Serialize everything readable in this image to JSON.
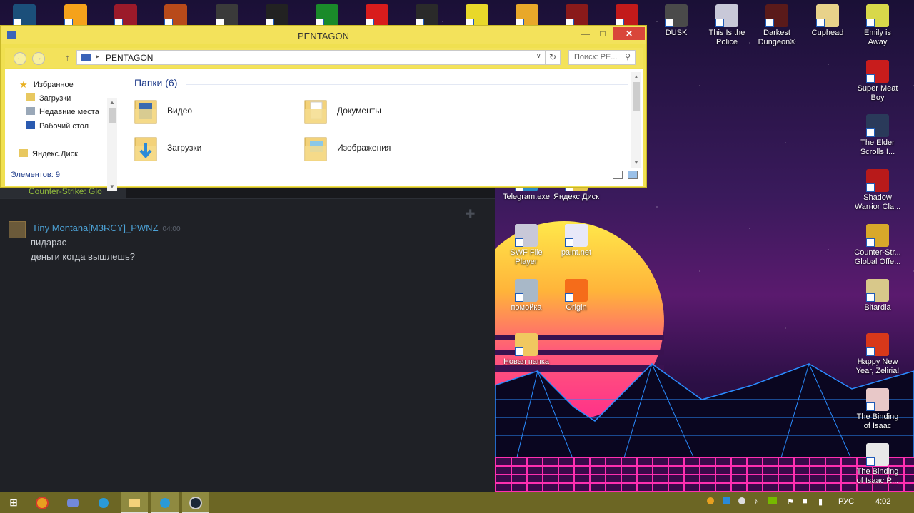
{
  "top_icons": [
    {
      "name": "steam-app-icon",
      "color": "#1b4f7a"
    },
    {
      "name": "app2-icon",
      "color": "#f5a21b"
    },
    {
      "name": "app3-icon",
      "color": "#9b1a2a"
    },
    {
      "name": "app4-icon",
      "color": "#b84a1a"
    },
    {
      "name": "app5-icon",
      "color": "#3a3a3a"
    },
    {
      "name": "app6-icon",
      "color": "#222222"
    },
    {
      "name": "app7-icon",
      "color": "#1a8a2a"
    },
    {
      "name": "app8-icon",
      "color": "#d81c1c"
    },
    {
      "name": "app9-icon",
      "color": "#2a2a2a"
    },
    {
      "name": "app10-icon",
      "color": "#e8d82a"
    },
    {
      "name": "app11-icon",
      "color": "#e8a82a"
    },
    {
      "name": "app12-icon",
      "color": "#8a1a1a"
    },
    {
      "name": "dota-icon",
      "color": "#c21a1a"
    }
  ],
  "desktop_right_top": [
    {
      "name": "DUSK",
      "color": "#4a4a4a"
    },
    {
      "name": "This Is the\nPolice",
      "color": "#c8c8d8"
    },
    {
      "name": "Darkest\nDungeon®",
      "color": "#5a1a1a"
    },
    {
      "name": "Cuphead",
      "color": "#e8d28a"
    },
    {
      "name": "Emily is\nAway",
      "color": "#d8d84a"
    }
  ],
  "desktop_right_col": [
    {
      "name": "Super Meat\nBoy",
      "color": "#c81c1c"
    },
    {
      "name": "The Elder\nScrolls I...",
      "color": "#2a3a5a"
    },
    {
      "name": "Shadow\nWarrior Cla...",
      "color": "#b81a1a"
    },
    {
      "name": "Counter-Str...\nGlobal Offe...",
      "color": "#d8a82a"
    },
    {
      "name": "Bitardia",
      "color": "#d8c88a"
    },
    {
      "name": "Happy New\nYear, Zeliria!",
      "color": "#d8381a"
    },
    {
      "name": "The Binding\nof Isaac",
      "color": "#e8c8c8"
    },
    {
      "name": "The Binding\nof Isaac R...",
      "color": "#e8e8e8"
    }
  ],
  "desktop_mid": [
    {
      "name": "Telegram.exe",
      "color": "#2a8ac8"
    },
    {
      "name": "Яндекс.Диск",
      "color": "#e8c84a"
    },
    {
      "name": "SWF File\nPlayer",
      "color": "#c8c8d8"
    },
    {
      "name": "paint.net",
      "color": "#e8e8f8"
    },
    {
      "name": "помойка",
      "color": "#a8b8c8"
    },
    {
      "name": "Origin",
      "color": "#f56c1a"
    },
    {
      "name": "Новая папка",
      "color": "#f0c860"
    }
  ],
  "explorer": {
    "title": "PENTAGON",
    "path": "PENTAGON",
    "search_placeholder": "Поиск: PE...",
    "nav": {
      "favorites": "Избранное",
      "downloads": "Загрузки",
      "recent": "Недавние места",
      "desktop": "Рабочий стол",
      "yandex": "Яндекс.Диск"
    },
    "group_title": "Папки (6)",
    "folders": [
      {
        "label": "Видео"
      },
      {
        "label": "Документы"
      },
      {
        "label": "Загрузки"
      },
      {
        "label": "Изображения"
      }
    ],
    "status": "Элементов: 9"
  },
  "chat": {
    "game_tab": "Counter-Strike: Glo",
    "sender": "Tiny Montana[M3RCY]_PWNZ",
    "time": "04:00",
    "messages": [
      "пидарас",
      "деньги когда вышлешь?"
    ]
  },
  "taskbar": {
    "lang": "РУС",
    "clock": "4:02"
  }
}
